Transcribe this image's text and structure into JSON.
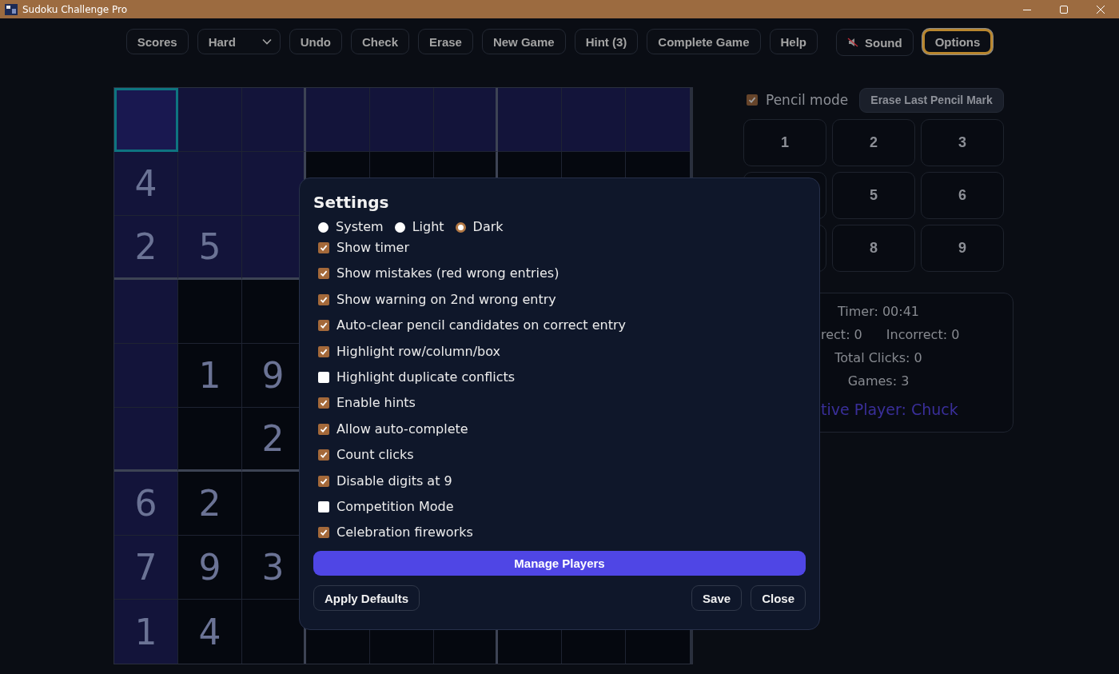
{
  "window": {
    "title": "Sudoku Challenge Pro"
  },
  "toolbar": [
    {
      "kind": "button",
      "label": "Scores",
      "selected": false
    },
    {
      "kind": "select",
      "label": "Hard",
      "selected": false
    },
    {
      "kind": "button",
      "label": "Undo",
      "selected": false
    },
    {
      "kind": "button",
      "label": "Check",
      "selected": false
    },
    {
      "kind": "button",
      "label": "Erase",
      "selected": false
    },
    {
      "kind": "button",
      "label": "New Game",
      "selected": false
    },
    {
      "kind": "button",
      "label": "Hint (3)",
      "selected": false
    },
    {
      "kind": "button",
      "label": "Complete Game",
      "selected": false
    },
    {
      "kind": "button",
      "label": "Help",
      "selected": false
    },
    {
      "kind": "sound",
      "label": "Sound",
      "selected": false
    },
    {
      "kind": "button",
      "label": "Options",
      "selected": true
    }
  ],
  "board": {
    "rows": [
      [
        {
          "selected": true,
          "highlighted": true
        },
        {
          "selected": false,
          "highlighted": true
        },
        {
          "selected": false,
          "highlighted": true
        },
        {
          "selected": false,
          "highlighted": true
        },
        {
          "selected": false,
          "highlighted": true
        },
        {
          "selected": false,
          "highlighted": true
        },
        {
          "selected": false,
          "highlighted": true
        },
        {
          "selected": false,
          "highlighted": true
        },
        {
          "selected": false,
          "highlighted": true
        }
      ],
      [
        {
          "value": "4",
          "selected": false,
          "highlighted": true
        },
        {
          "selected": false,
          "highlighted": true
        },
        {
          "selected": false,
          "highlighted": true
        },
        {
          "selected": false,
          "highlighted": false
        },
        {
          "selected": false,
          "highlighted": false
        },
        {
          "selected": false,
          "highlighted": false
        },
        {
          "selected": false,
          "highlighted": false
        },
        {
          "selected": false,
          "highlighted": false
        },
        {
          "selected": false,
          "highlighted": false
        }
      ],
      [
        {
          "value": "2",
          "selected": false,
          "highlighted": true
        },
        {
          "value": "5",
          "selected": false,
          "highlighted": true
        },
        {
          "selected": false,
          "highlighted": true
        }
      ],
      [
        {
          "selected": false,
          "highlighted": true
        },
        {
          "selected": false,
          "highlighted": false
        },
        {
          "selected": false,
          "highlighted": false
        }
      ],
      [
        {
          "selected": false,
          "highlighted": true
        },
        {
          "value": "1",
          "selected": false,
          "highlighted": false
        },
        {
          "value": "9",
          "selected": false,
          "highlighted": false
        }
      ],
      [
        {
          "selected": false,
          "highlighted": true
        },
        {
          "selected": false,
          "highlighted": false
        },
        {
          "value": "2",
          "selected": false,
          "highlighted": false
        }
      ],
      [
        {
          "value": "6",
          "selected": false,
          "highlighted": true
        },
        {
          "value": "2",
          "selected": false,
          "highlighted": false
        },
        {
          "selected": false,
          "highlighted": false
        }
      ],
      [
        {
          "value": "7",
          "selected": false,
          "highlighted": true
        },
        {
          "value": "9",
          "selected": false,
          "highlighted": false
        },
        {
          "value": "3",
          "selected": false,
          "highlighted": false
        }
      ],
      [
        {
          "value": "1",
          "selected": false,
          "highlighted": true
        },
        {
          "value": "4",
          "selected": false,
          "highlighted": false
        },
        {
          "selected": false,
          "highlighted": false
        },
        {
          "selected": false,
          "highlighted": false
        },
        {
          "selected": false,
          "highlighted": false
        },
        {
          "selected": false,
          "highlighted": false
        },
        {
          "selected": false,
          "highlighted": false
        },
        {
          "selected": false,
          "highlighted": false
        },
        {
          "selected": false,
          "highlighted": false
        }
      ]
    ]
  },
  "side": {
    "pencil_mode": {
      "label": "Pencil mode",
      "checked": true
    },
    "erase_pencil": "Erase Last Pencil Mark",
    "numpad": [
      [
        "1",
        "2",
        "3"
      ],
      [
        "5",
        "6"
      ],
      [
        "8",
        "9"
      ]
    ],
    "stats": {
      "timer": "Timer: 00:41",
      "correct": "rect: 0",
      "incorrect": "Incorrect: 0",
      "clicks": "Total Clicks: 0",
      "games": "Games: 3",
      "player": "tive Player: Chuck"
    }
  },
  "settings": {
    "title": "Settings",
    "theme": [
      {
        "label": "System",
        "selected": false
      },
      {
        "label": "Light",
        "selected": false
      },
      {
        "label": "Dark",
        "selected": true
      }
    ],
    "options": [
      {
        "label": "Show timer",
        "checked": true
      },
      {
        "label": "Show mistakes (red wrong entries)",
        "checked": true
      },
      {
        "label": "Show warning on 2nd wrong entry",
        "checked": true
      },
      {
        "label": "Auto-clear pencil candidates on correct entry",
        "checked": true
      },
      {
        "label": "Highlight row/column/box",
        "checked": true
      },
      {
        "label": "Highlight duplicate conflicts",
        "checked": false
      },
      {
        "label": "Enable hints",
        "checked": true
      },
      {
        "label": "Allow auto-complete",
        "checked": true
      },
      {
        "label": "Count clicks",
        "checked": true
      },
      {
        "label": "Disable digits at 9",
        "checked": true
      },
      {
        "label": "Competition Mode",
        "checked": false
      },
      {
        "label": "Celebration fireworks",
        "checked": true
      }
    ],
    "manage_players": "Manage Players",
    "apply_defaults": "Apply Defaults",
    "save": "Save",
    "close": "Close"
  }
}
